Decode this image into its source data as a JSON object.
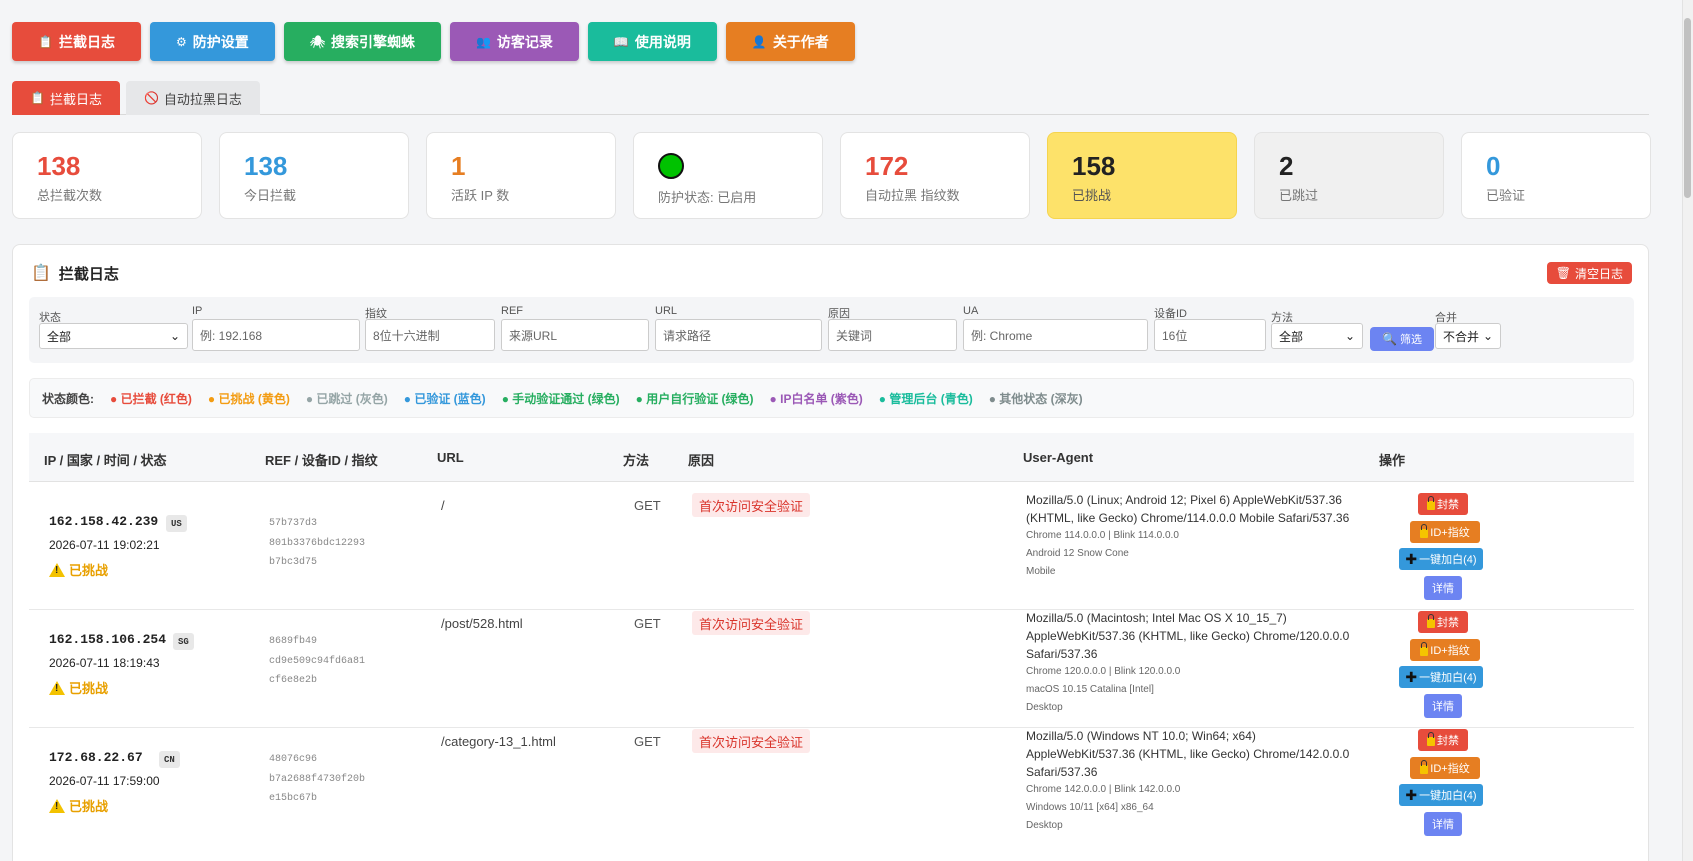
{
  "top_tabs": [
    {
      "label": "拦截日志",
      "icon": "clipboard-icon",
      "color": "#e74c3c"
    },
    {
      "label": "防护设置",
      "icon": "gear-icon",
      "color": "#3498db"
    },
    {
      "label": "搜索引擎蜘蛛",
      "icon": "spider-icon",
      "color": "#27ae60"
    },
    {
      "label": "访客记录",
      "icon": "users-icon",
      "color": "#9b59b6"
    },
    {
      "label": "使用说明",
      "icon": "book-icon",
      "color": "#1abc9c"
    },
    {
      "label": "关于作者",
      "icon": "user-icon",
      "color": "#e67e22"
    }
  ],
  "sub_tabs": [
    {
      "label": "拦截日志",
      "icon": "clipboard-icon"
    },
    {
      "label": "自动拉黑日志",
      "icon": "no-entry-icon"
    }
  ],
  "stats": [
    {
      "value": "138",
      "label": "总拦截次数",
      "color": "#e74c3c"
    },
    {
      "value": "138",
      "label": "今日拦截",
      "color": "#3498db"
    },
    {
      "value": "1",
      "label": "活跃 IP 数",
      "color": "#e67e22"
    },
    {
      "value": "",
      "label": "防护状态: 已启用",
      "color": "#00c200"
    },
    {
      "value": "172",
      "label": "自动拉黑 指纹数",
      "color": "#e74c3c"
    },
    {
      "value": "158",
      "label": "已挑战",
      "color": "#222222"
    },
    {
      "value": "2",
      "label": "已跳过",
      "color": "#222222"
    },
    {
      "value": "0",
      "label": "已验证",
      "color": "#3498db"
    }
  ],
  "panel": {
    "title": "拦截日志",
    "clear_button": "清空日志"
  },
  "filters": {
    "status": {
      "label": "状态",
      "value": "全部"
    },
    "ip": {
      "label": "IP",
      "placeholder": "例: 192.168"
    },
    "fingerprint": {
      "label": "指纹",
      "placeholder": "8位十六进制"
    },
    "ref": {
      "label": "REF",
      "placeholder": "来源URL"
    },
    "url": {
      "label": "URL",
      "placeholder": "请求路径"
    },
    "reason": {
      "label": "原因",
      "placeholder": "关键词"
    },
    "ua": {
      "label": "UA",
      "placeholder": "例: Chrome"
    },
    "device": {
      "label": "设备ID",
      "placeholder": "16位"
    },
    "method": {
      "label": "方法",
      "value": "全部"
    },
    "filter_button": "筛选",
    "merge": {
      "label": "合并",
      "value": "不合并"
    }
  },
  "legend": {
    "title": "状态颜色:",
    "items": [
      {
        "text": "● 已拦截 (红色)",
        "color": "#e74c3c"
      },
      {
        "text": "● 已挑战 (黄色)",
        "color": "#f39c12"
      },
      {
        "text": "● 已跳过 (灰色)",
        "color": "#95a5a6"
      },
      {
        "text": "● 已验证 (蓝色)",
        "color": "#3498db"
      },
      {
        "text": "● 手动验证通过 (绿色)",
        "color": "#27ae60"
      },
      {
        "text": "● 用户自行验证 (绿色)",
        "color": "#27ae60"
      },
      {
        "text": "● IP白名单 (紫色)",
        "color": "#9b59b6"
      },
      {
        "text": "● 管理后台 (青色)",
        "color": "#1abc9c"
      },
      {
        "text": "● 其他状态 (深灰)",
        "color": "#7f8c8d"
      }
    ]
  },
  "table": {
    "headers": [
      "IP / 国家 / 时间 / 状态",
      "REF / 设备ID / 指纹",
      "URL",
      "方法",
      "原因",
      "User-Agent",
      "操作"
    ],
    "rows": [
      {
        "ip": "162.158.42.239",
        "country": "US",
        "time": "2026-07-11 19:02:21",
        "status": "已挑战",
        "ref": "57b737d3",
        "device": "801b3376bdc12293",
        "fp": "b7bc3d75",
        "url": "/",
        "method": "GET",
        "reason": "首次访问安全验证",
        "ua": "Mozilla/5.0 (Linux; Android 12; Pixel 6) AppleWebKit/537.36 (KHTML, like Gecko) Chrome/114.0.0.0 Mobile Safari/537.36",
        "ua_browser": "Chrome 114.0.0.0 | Blink 114.0.0.0",
        "ua_os": "Android 12 Snow Cone",
        "ua_device": "Mobile",
        "ops": {
          "ban": "封禁",
          "idfp": "ID+指纹",
          "whitelist": "一键加白(4)",
          "detail": "详情"
        }
      },
      {
        "ip": "162.158.106.254",
        "country": "SG",
        "time": "2026-07-11 18:19:43",
        "status": "已挑战",
        "ref": "8689fb49",
        "device": "cd9e509c94fd6a81",
        "fp": "cf6e8e2b",
        "url": "/post/528.html",
        "method": "GET",
        "reason": "首次访问安全验证",
        "ua": "Mozilla/5.0 (Macintosh; Intel Mac OS X 10_15_7) AppleWebKit/537.36 (KHTML, like Gecko) Chrome/120.0.0.0 Safari/537.36",
        "ua_browser": "Chrome 120.0.0.0 | Blink 120.0.0.0",
        "ua_os": "macOS 10.15 Catalina [Intel]",
        "ua_device": "Desktop",
        "ops": {
          "ban": "封禁",
          "idfp": "ID+指纹",
          "whitelist": "一键加白(4)",
          "detail": "详情"
        }
      },
      {
        "ip": "172.68.22.67",
        "country": "CN",
        "time": "2026-07-11 17:59:00",
        "status": "已挑战",
        "ref": "48076c96",
        "device": "b7a2688f4730f20b",
        "fp": "e15bc67b",
        "url": "/category-13_1.html",
        "method": "GET",
        "reason": "首次访问安全验证",
        "ua": "Mozilla/5.0 (Windows NT 10.0; Win64; x64) AppleWebKit/537.36 (KHTML, like Gecko) Chrome/142.0.0.0 Safari/537.36",
        "ua_browser": "Chrome 142.0.0.0 | Blink 142.0.0.0",
        "ua_os": "Windows 10/11 [x64] x86_64",
        "ua_device": "Desktop",
        "ops": {
          "ban": "封禁",
          "idfp": "ID+指纹",
          "whitelist": "一键加白(4)",
          "detail": "详情"
        }
      }
    ]
  }
}
